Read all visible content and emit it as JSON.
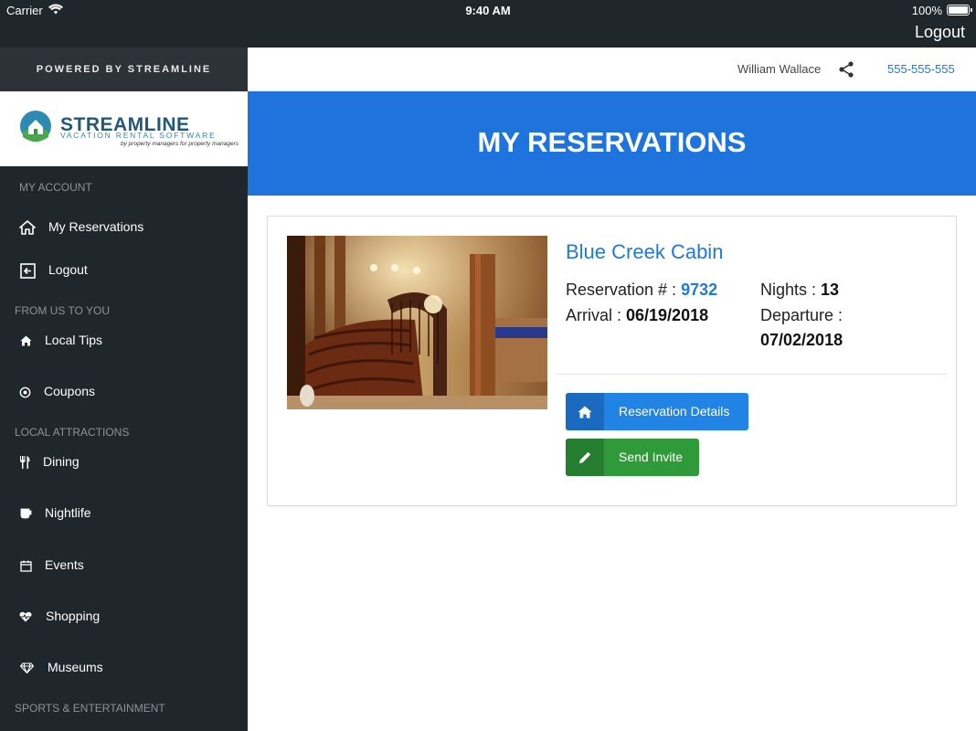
{
  "status_bar": {
    "carrier": "Carrier",
    "time": "9:40 AM",
    "battery": "100%"
  },
  "nav": {
    "logout_label": "Logout"
  },
  "sidebar": {
    "powered_by": "POWERED BY STREAMLINE",
    "logo": {
      "name": "STREAMLINE",
      "subtitle": "VACATION RENTAL SOFTWARE",
      "tagline": "by property managers for property managers"
    },
    "sections": {
      "my_account": "MY ACCOUNT",
      "from_us": "FROM US TO YOU",
      "local_attractions": "LOCAL ATTRACTIONS",
      "sports": "SPORTS & ENTERTAINMENT"
    },
    "items": {
      "my_reservations": "My Reservations",
      "logout": "Logout",
      "local_tips": "Local Tips",
      "coupons": "Coupons",
      "dining": "Dining",
      "nightlife": "Nightlife",
      "events": "Events",
      "shopping": "Shopping",
      "museums": "Museums"
    }
  },
  "header": {
    "user_name": "William Wallace",
    "phone": "555-555-555"
  },
  "hero": {
    "title": "MY RESERVATIONS"
  },
  "reservation": {
    "property_name": "Blue Creek Cabin",
    "reservation_label": "Reservation # : ",
    "reservation_number": "9732",
    "nights_label": "Nights : ",
    "nights": "13",
    "arrival_label": "Arrival : ",
    "arrival": "06/19/2018",
    "departure_label": "Departure :",
    "departure": "07/02/2018",
    "details_button": "Reservation Details",
    "invite_button": "Send Invite"
  },
  "colors": {
    "accent": "#1e74dc",
    "link": "#1f7ad8",
    "sidebar": "#1f262c",
    "green": "#2e9a3a"
  }
}
